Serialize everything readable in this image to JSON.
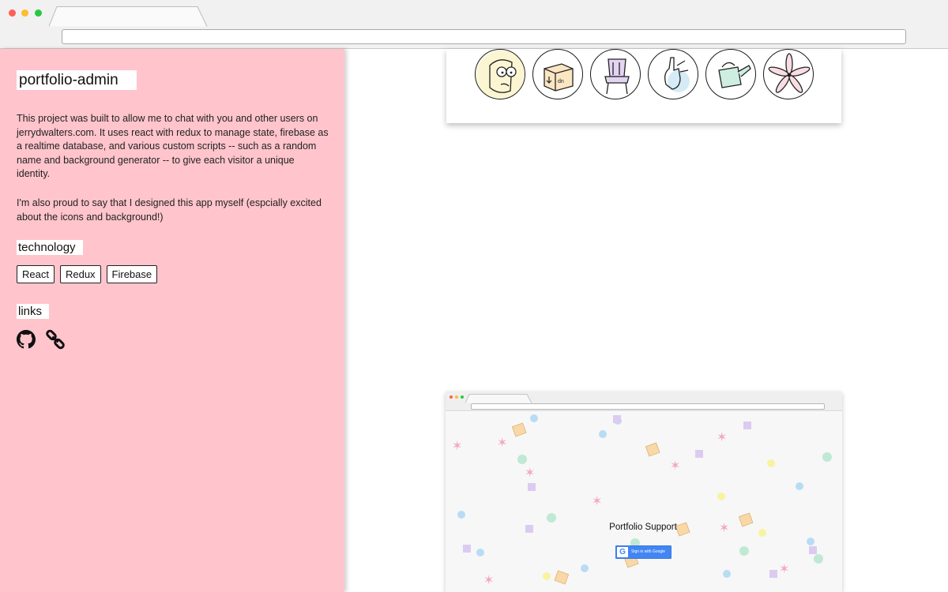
{
  "project": {
    "title": "portfolio-admin",
    "description_1": "This project was built to allow me to chat with you and other users on jerrydwalters.com. It uses react with redux to manage state, firebase as a realtime database, and various custom scripts -- such as a random name and background generator -- to give each visitor a unique identity.",
    "description_2": "I'm also proud to say that I designed this app myself (espcially excited about the icons and background!)"
  },
  "technology": {
    "heading": "technology",
    "tags": [
      "React",
      "Redux",
      "Firebase"
    ]
  },
  "links": {
    "heading": "links",
    "icons": [
      "github-icon",
      "link-icon"
    ]
  },
  "gallery": {
    "icons": [
      "rick-face-icon",
      "package-box-icon",
      "chair-icon",
      "hand-gesture-icon",
      "watering-can-icon",
      "flower-icon"
    ]
  },
  "screenshot_preview": {
    "title": "Portfolio Support",
    "google_signin_label": "Sign in with Google"
  },
  "colors": {
    "panel_background": "#ffc4cc",
    "google_blue": "#4285f4"
  }
}
